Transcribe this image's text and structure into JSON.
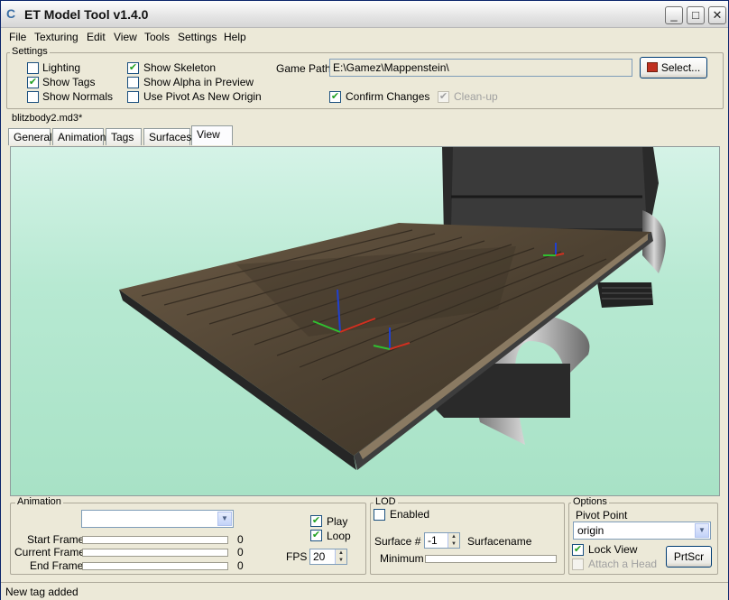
{
  "window": {
    "title": "ET Model Tool v1.4.0"
  },
  "menu": [
    "File",
    "Texturing",
    "Edit",
    "View",
    "Tools",
    "Settings",
    "Help"
  ],
  "settings": {
    "group_label": "Settings",
    "lighting": {
      "label": "Lighting",
      "checked": false
    },
    "show_tags": {
      "label": "Show Tags",
      "checked": true
    },
    "show_normals": {
      "label": "Show Normals",
      "checked": false
    },
    "show_skeleton": {
      "label": "Show Skeleton",
      "checked": true
    },
    "show_alpha": {
      "label": "Show Alpha in Preview",
      "checked": false
    },
    "use_pivot": {
      "label": "Use Pivot As New Origin",
      "checked": false
    },
    "game_path_label": "Game Path",
    "game_path_value": "E:\\Gamez\\Mappenstein\\",
    "select_button": "Select...",
    "confirm_changes": {
      "label": "Confirm Changes",
      "checked": true
    },
    "cleanup": {
      "label": "Clean-up",
      "checked": true,
      "disabled": true
    }
  },
  "model_name": "blitzbody2.md3*",
  "tabs": [
    "General",
    "Animation",
    "Tags",
    "Surfaces",
    "View"
  ],
  "active_tab": "View",
  "animation": {
    "group_label": "Animation",
    "selected": "",
    "start_frame_label": "Start Frame",
    "current_frame_label": "Current Frame",
    "end_frame_label": "End Frame",
    "start_frame_value": "0",
    "current_frame_value": "0",
    "end_frame_value": "0",
    "play": {
      "label": "Play",
      "checked": true
    },
    "loop": {
      "label": "Loop",
      "checked": true
    },
    "fps_label": "FPS",
    "fps_value": "20"
  },
  "lod": {
    "group_label": "LOD",
    "enabled": {
      "label": "Enabled",
      "checked": false
    },
    "surface_label": "Surface #",
    "surface_value": "-1",
    "surfacename_label": "Surfacename",
    "minimum_label": "Minimum"
  },
  "options": {
    "group_label": "Options",
    "pivot_label": "Pivot Point",
    "pivot_value": "origin",
    "lock_view": {
      "label": "Lock View",
      "checked": true
    },
    "attach_head": {
      "label": "Attach a Head",
      "checked": false,
      "disabled": true
    },
    "prtscr_button": "PrtScr"
  },
  "status": "New tag added",
  "colors": {
    "viewport_bg": "#b7e9d2",
    "wood": "#5a4a38",
    "axis_x": "#d03020",
    "axis_y": "#30c030",
    "axis_z": "#2040d0"
  }
}
